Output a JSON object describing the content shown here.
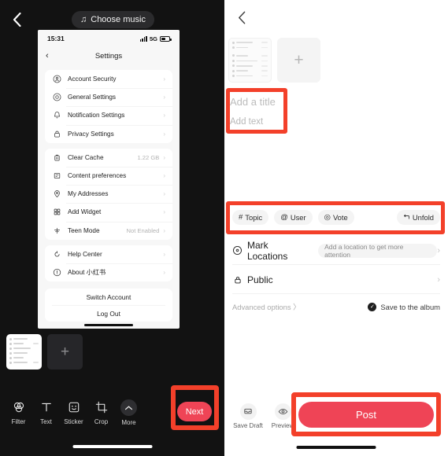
{
  "left_panel": {
    "back_icon": "chevron-left-icon",
    "music_button": {
      "label": "Choose music",
      "icon": "music-note-icon"
    },
    "preview": {
      "status_bar": {
        "time": "15:31",
        "network": "5G",
        "signal_icon": "signal-bars-icon",
        "battery_icon": "battery-icon"
      },
      "nav": {
        "back_icon": "chevron-left-icon",
        "title": "Settings"
      },
      "group_one": [
        {
          "icon": "account-security-icon",
          "label": "Account Security",
          "value": "",
          "chevron": "›"
        },
        {
          "icon": "general-settings-icon",
          "label": "General Settings",
          "value": "",
          "chevron": "›"
        },
        {
          "icon": "notification-bell-icon",
          "label": "Notification Settings",
          "value": "",
          "chevron": "›"
        },
        {
          "icon": "privacy-lock-icon",
          "label": "Privacy Settings",
          "value": "",
          "chevron": "›"
        }
      ],
      "group_two": [
        {
          "icon": "trash-icon",
          "label": "Clear Cache",
          "value": "1.22 GB",
          "chevron": "›"
        },
        {
          "icon": "content-preferences-icon",
          "label": "Content preferences",
          "value": "",
          "chevron": "›"
        },
        {
          "icon": "location-pin-icon",
          "label": "My Addresses",
          "value": "",
          "chevron": "›"
        },
        {
          "icon": "widget-grid-icon",
          "label": "Add Widget",
          "value": "",
          "chevron": "›"
        },
        {
          "icon": "teen-mode-icon",
          "label": "Teen Mode",
          "value": "Not Enabled",
          "chevron": "›"
        }
      ],
      "group_three": [
        {
          "icon": "help-center-icon",
          "label": "Help Center",
          "value": "",
          "chevron": "›"
        },
        {
          "icon": "info-circle-icon",
          "label": "About 小红书",
          "value": "",
          "chevron": "›"
        }
      ],
      "actions": [
        {
          "label": "Switch Account"
        },
        {
          "label": "Log Out"
        }
      ]
    },
    "thumbnails": {
      "add_icon": "plus-icon",
      "add_label": "+"
    },
    "tools": [
      {
        "icon": "filter-icon",
        "label": "Filter"
      },
      {
        "icon": "text-icon",
        "label": "Text"
      },
      {
        "icon": "sticker-icon",
        "label": "Sticker"
      },
      {
        "icon": "crop-icon",
        "label": "Crop"
      },
      {
        "icon": "chevron-up-icon",
        "label": "More"
      }
    ],
    "next_button": {
      "label": "Next",
      "color": "#ef4456",
      "highlight_color": "#f3402a"
    }
  },
  "right_panel": {
    "back_icon": "chevron-left-icon",
    "thumbnails": {
      "add_icon": "plus-icon",
      "add_label": "+"
    },
    "title_placeholder": "Add a title",
    "text_placeholder": "Add text",
    "title_highlight_color": "#f3402a",
    "chips": [
      {
        "icon": "hash-icon",
        "glyph": "#",
        "label": "Topic"
      },
      {
        "icon": "at-icon",
        "glyph": "@",
        "label": "User"
      },
      {
        "icon": "vote-icon",
        "glyph": "◎",
        "label": "Vote"
      }
    ],
    "unfold": {
      "icon": "unfold-icon",
      "label": "Unfold"
    },
    "chips_highlight_color": "#f3402a",
    "location_row": {
      "icon": "location-target-icon",
      "label": "Mark Locations",
      "pill": "Add a location to get more attention",
      "chevron": "›"
    },
    "visibility_row": {
      "icon": "lock-icon",
      "label": "Public",
      "chevron": "›"
    },
    "advanced": {
      "link": "Advanced options 〉",
      "save_label": "Save to the album",
      "save_checked": true,
      "check_icon": "check-circle-icon"
    },
    "bottom_actions": [
      {
        "icon": "save-draft-icon",
        "label": "Save Draft"
      },
      {
        "icon": "preview-eye-icon",
        "label": "Preview"
      }
    ],
    "post_button": {
      "label": "Post",
      "color": "#ef4456",
      "highlight_color": "#f3402a"
    }
  }
}
